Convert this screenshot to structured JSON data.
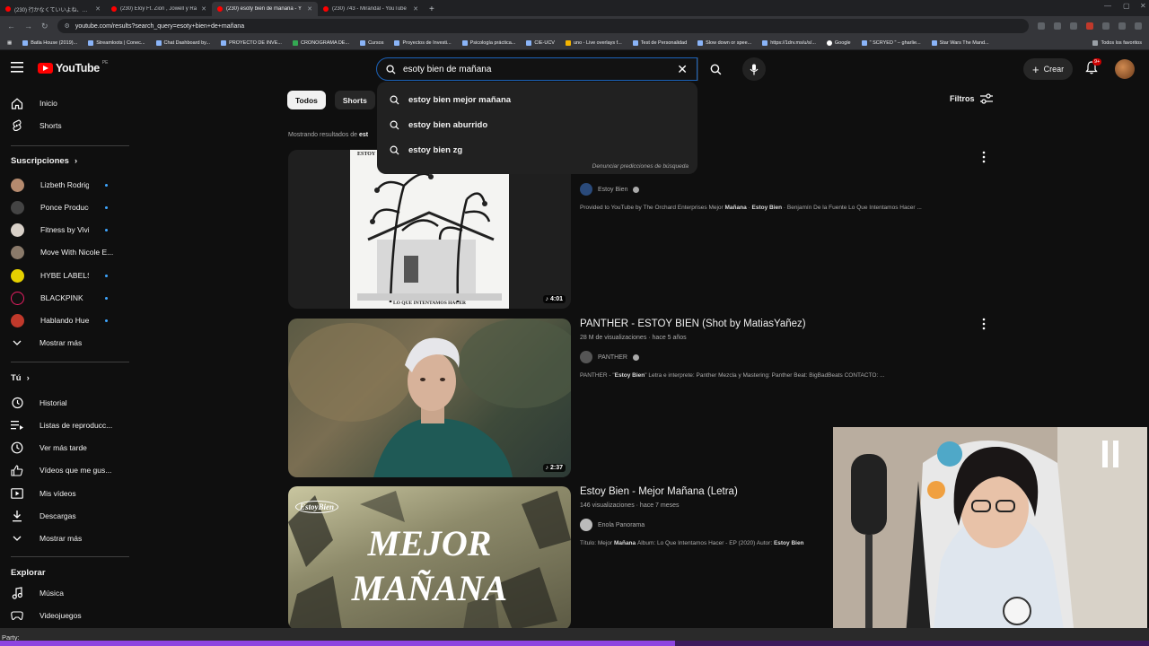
{
  "browser": {
    "tabs": [
      {
        "label": "(230) 行かなくていいよね、この道"
      },
      {
        "label": "(230) Eloy Ft. Zion , Jowell y Ra"
      },
      {
        "label": "(230) esoty bien de mañana - Y"
      },
      {
        "label": "(230) 743 - Mirandal - YouTube"
      }
    ],
    "url": "youtube.com/results?search_query=esoty+bien+de+mañana",
    "bookmarks": [
      "Batla House (2019)...",
      "Streamloots | Conec...",
      "Chat Dashboard by...",
      "PROYECTO DE INVE...",
      "CRONOGRAMA DE...",
      "Cursos",
      "Proyectos de Investi...",
      "Psicología práctica...",
      "CIE-UCV",
      "uno - Live overlays f...",
      "Test de Personalidad",
      "Slow down or spee...",
      "https://1drv.ms/u/s/...",
      "Google",
      "\" SCRYED \" – gharlie...",
      "Star Wars The Mand..."
    ],
    "all_bookmarks_label": "Todos los favoritos"
  },
  "header": {
    "logo_text": "YouTube",
    "country_code": "PE",
    "search_value": "esoty bien de mañana",
    "create_label": "Crear",
    "notif_count": "9+"
  },
  "sidebar": {
    "main": [
      {
        "label": "Inicio",
        "icon": "home-icon"
      },
      {
        "label": "Shorts",
        "icon": "shorts-icon"
      }
    ],
    "subs_title": "Suscripciones",
    "subs": [
      {
        "label": "Lizbeth Rodriguez",
        "color": "#b58a6e"
      },
      {
        "label": "Ponce Produccıo...",
        "color": "#444444"
      },
      {
        "label": "Fitness by Vivi",
        "color": "#d8d0c8"
      },
      {
        "label": "Move With Nicole E...",
        "color": "#8a7a6a"
      },
      {
        "label": "HYBE LABELS",
        "color": "#e5d000"
      },
      {
        "label": "BLACKPINK",
        "color": "#111111"
      },
      {
        "label": "Hablando Huevа...",
        "color": "#c0392b"
      }
    ],
    "subs_more": "Mostrar más",
    "you_title": "Tú",
    "you": [
      {
        "label": "Historial"
      },
      {
        "label": "Listas de reproducc..."
      },
      {
        "label": "Ver más tarde"
      },
      {
        "label": "Vídeos que me gus..."
      },
      {
        "label": "Mis vídeos"
      },
      {
        "label": "Descargas"
      },
      {
        "label": "Mostrar más"
      }
    ],
    "explore_title": "Explorar",
    "explore": [
      {
        "label": "Música"
      },
      {
        "label": "Videojuegos"
      }
    ]
  },
  "chips": [
    "Todos",
    "Shorts"
  ],
  "filters_label": "Filtros",
  "showing_prefix": "Mostrando resultados de",
  "showing_query": "est",
  "suggestions": [
    "estoy bien mejor mañana",
    "estoy bien aburrido",
    "estoy bien zg"
  ],
  "report_label": "Denunciar predicciones de búsqueda",
  "results": [
    {
      "title": "",
      "meta": "",
      "channel": "Estoy Bien",
      "desc_pre": "Provided to YouTube by The Orchard Enterprises Mejor ",
      "desc_b1": "Mañana",
      "desc_mid": " · ",
      "desc_b2": "Estoy Bien",
      "desc_post": " · Benjamín De la Fuente Lo Que Intentamos Hacer ...",
      "duration": "4:01",
      "cover_top": "ESTOY",
      "cover_bottom": "LO QUE INTENTAMOS HACER"
    },
    {
      "title": "PANTHER - ESTOY BIEN (Shot by MatiasYañez)",
      "meta": "28 M de visualizaciones · hace 5 años",
      "channel": "PANTHER",
      "desc_pre": "PANTHER - \"",
      "desc_b1": "Estoy Bien",
      "desc_mid": "\" Letra e interprete: Panther Mezcla y Mastering: Panther Beat: BigBadBeats CONTACTO: ...",
      "desc_b2": "",
      "desc_post": "",
      "duration": "2:37"
    },
    {
      "title": "Estoy Bien - Mejor Mañana (Letra)",
      "meta": "146 visualizaciones · hace 7 meses",
      "channel": "Enola Panorama",
      "desc_pre": "Título: Mejor ",
      "desc_b1": "Mañana",
      "desc_mid": " Álbum: Lo Que Intentamos Hacer - EP (2020) Autor: ",
      "desc_b2": "Estoy Bien",
      "desc_post": "",
      "duration": "",
      "thumb_small": "EstoyBien",
      "thumb_line1": "MEJOR",
      "thumb_line2": "MAÑANA"
    }
  ],
  "status_text": "Party:"
}
